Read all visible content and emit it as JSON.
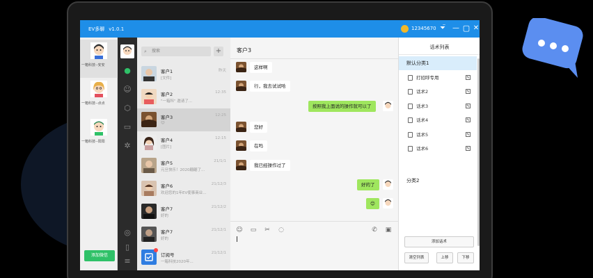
{
  "window": {
    "app_name": "EV多聊",
    "version": "v1.0.1",
    "account": "12345670",
    "colors": {
      "titlebar": "#1e8ee8",
      "accent_green": "#2fc168",
      "bubble_out": "#9fe65e",
      "selected_category": "#d9edfb"
    }
  },
  "previews": [
    {
      "label": "一箱科技--安安"
    },
    {
      "label": "一箱科技--点点"
    },
    {
      "label": "一箱科技--阳阳"
    }
  ],
  "previews_add_button": "添加微信",
  "nav_icons": [
    "chat-icon",
    "contacts-icon",
    "box-icon",
    "folder-icon",
    "settings-icon",
    "compass-icon",
    "phone-icon",
    "menu-icon"
  ],
  "chat_list": {
    "search_placeholder": "搜索",
    "rows": [
      {
        "name": "客户1",
        "msg": "[文件]",
        "time": "昨天"
      },
      {
        "name": "客户2",
        "msg": "\"一箱科\" 邀请了...",
        "time": "12:35"
      },
      {
        "name": "客户3",
        "msg": "😊",
        "time": "12:25"
      },
      {
        "name": "客户4",
        "msg": "[图片]",
        "time": "12:15"
      },
      {
        "name": "客户5",
        "msg": "元旦快乐！2020翩翩了...",
        "time": "21/1/1"
      },
      {
        "name": "客户6",
        "msg": "欢迎您的1年EV使事商业...",
        "time": "21/12/3"
      },
      {
        "name": "客户7",
        "msg": "好的",
        "time": "21/12/2"
      },
      {
        "name": "客户7",
        "msg": "好的",
        "time": "21/12/1"
      },
      {
        "name": "订阅号",
        "msg": "一箱科技2020年...",
        "time": "21/12/1"
      }
    ]
  },
  "chat": {
    "title": "客户3",
    "messages": [
      {
        "dir": "in",
        "text": "这样啊"
      },
      {
        "dir": "in",
        "text": "行，我去试试哈"
      },
      {
        "dir": "out",
        "text": "按照我上面说的操作就可以了"
      },
      {
        "dir": "in",
        "text": "您好"
      },
      {
        "dir": "in",
        "text": "在吗"
      },
      {
        "dir": "in",
        "text": "我已经操作过了"
      },
      {
        "dir": "out",
        "text": "好的了"
      },
      {
        "dir": "out",
        "text": "😊"
      }
    ],
    "composer_tools": [
      "emoji-icon",
      "folder-icon",
      "scissors-icon",
      "chat-bubble-icon",
      "phone-icon",
      "video-icon"
    ]
  },
  "panel": {
    "title": "话术列表",
    "categories": [
      {
        "label": "默认分类1",
        "items": [
          "打招呼专用",
          "话术2",
          "话术3",
          "话术4",
          "话术5",
          "话术6"
        ]
      },
      {
        "label": "分类2",
        "items": []
      }
    ],
    "add_button": "添加话术",
    "clear_button": "清空列表",
    "up_button": "上移",
    "down_button": "下移"
  }
}
